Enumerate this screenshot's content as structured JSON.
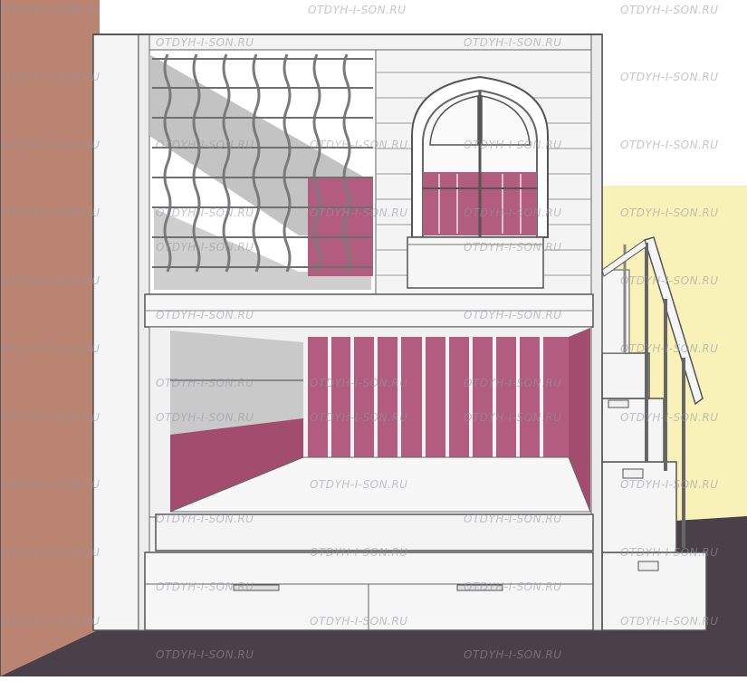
{
  "image": {
    "subject": "bunk-bed-house-3d-render",
    "colors": {
      "wall_left": "#b98471",
      "wall_right": "#f9f2b8",
      "floor": "#4a4049",
      "furniture": "#f4f4f4",
      "accent_pink": "#b25c7f",
      "lines": "#555555"
    }
  },
  "watermark": {
    "text": "OTDYH-I-SON.RU"
  }
}
